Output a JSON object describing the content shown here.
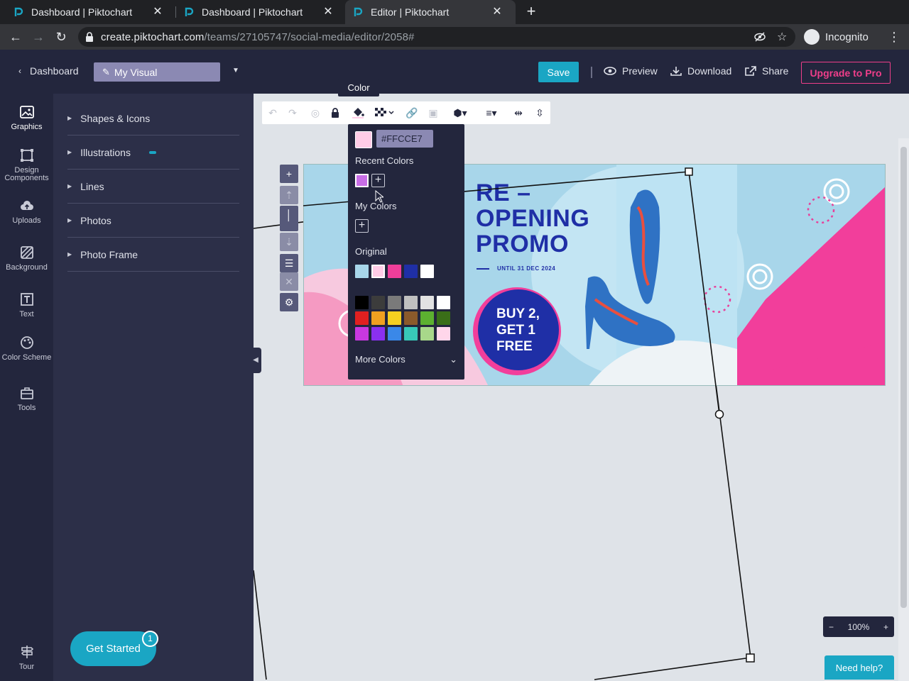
{
  "browser": {
    "tabs": [
      {
        "label": "Dashboard | Piktochart",
        "active": false
      },
      {
        "label": "Dashboard | Piktochart",
        "active": false
      },
      {
        "label": "Editor | Piktochart",
        "active": true
      }
    ],
    "url_host": "create.piktochart.com",
    "url_path": "/teams/27105747/social-media/editor/2058#",
    "incognito_label": "Incognito"
  },
  "header": {
    "back_label": "Dashboard",
    "title": "My Visual",
    "save_label": "Save",
    "preview_label": "Preview",
    "download_label": "Download",
    "share_label": "Share",
    "upgrade_label": "Upgrade to Pro"
  },
  "rail": [
    {
      "label": "Graphics",
      "icon": "image-icon",
      "active": true
    },
    {
      "label": "Design Components",
      "icon": "components-icon",
      "active": false
    },
    {
      "label": "Uploads",
      "icon": "cloud-upload-icon",
      "active": false
    },
    {
      "label": "Background",
      "icon": "hatch-icon",
      "active": false
    },
    {
      "label": "Text",
      "icon": "text-icon",
      "active": false
    },
    {
      "label": "Color Scheme",
      "icon": "palette-icon",
      "active": false
    },
    {
      "label": "Tools",
      "icon": "toolbox-icon",
      "active": false
    }
  ],
  "rail_tour_label": "Tour",
  "panel": {
    "categories": [
      "Shapes & Icons",
      "Illustrations",
      "Lines",
      "Photos",
      "Photo Frame"
    ]
  },
  "get_started": {
    "label": "Get Started",
    "badge": "1"
  },
  "tooltip": "Color",
  "color_popup": {
    "current_hex": "#FFCCE7",
    "recent_label": "Recent Colors",
    "recent": [
      "#c86ee6"
    ],
    "my_colors_label": "My Colors",
    "original_label": "Original",
    "original": [
      "#a8d6ea",
      "#ffcce7",
      "#ef3e9a",
      "#1f2fa6",
      "#ffffff"
    ],
    "palette": [
      "#000000",
      "#3c3c3c",
      "#7a7a7a",
      "#c0c0c0",
      "#e2e2e2",
      "#ffffff",
      "#e02020",
      "#f0a020",
      "#f5d020",
      "#8b5a2b",
      "#5cb030",
      "#3a6e18",
      "#c838e0",
      "#8a30f0",
      "#3a88e8",
      "#38c8b8",
      "#a8d88a",
      "#ffd6ea"
    ],
    "more_label": "More Colors"
  },
  "design": {
    "headline": [
      "RE –",
      "OPENING",
      "PROMO"
    ],
    "until": "UNTIL 31 DEC 2024",
    "offer": [
      "BUY 2,",
      "GET 1",
      "FREE"
    ]
  },
  "zoom": {
    "value": "100%",
    "minus": "−",
    "plus": "+"
  },
  "help_label": "Need help?"
}
